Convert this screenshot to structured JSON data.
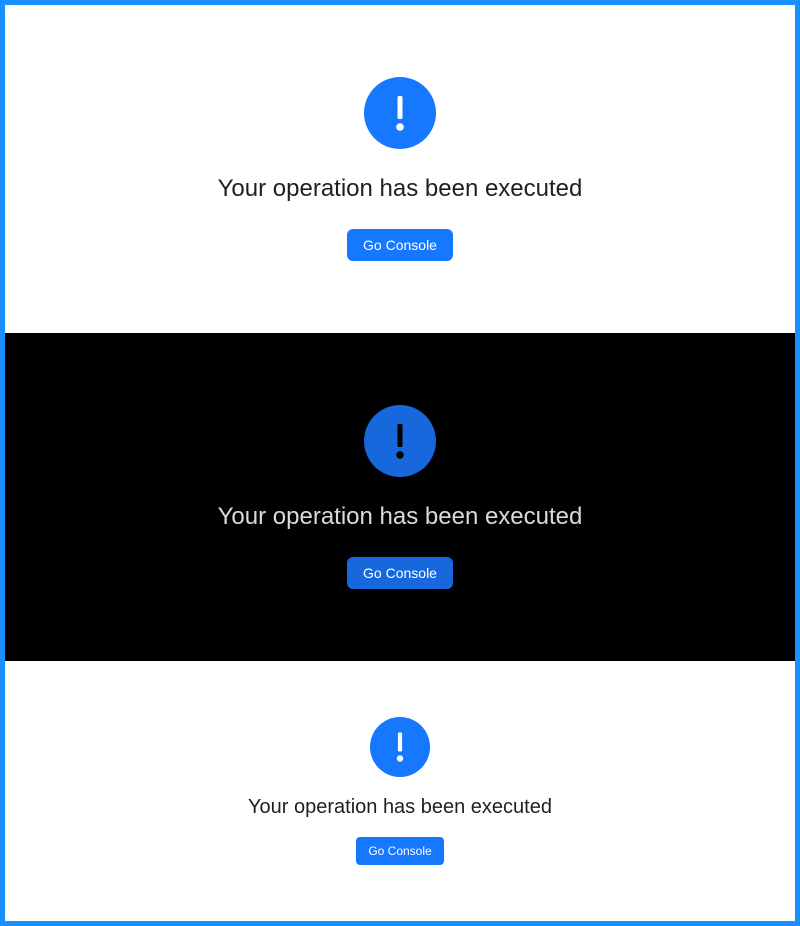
{
  "colors": {
    "outer_border": "#1890ff",
    "primary": "#1677ff",
    "primary_dark": "#1668dc",
    "light_bg": "#ffffff",
    "dark_bg": "#000000"
  },
  "results": [
    {
      "theme": "light",
      "icon": "exclamation-circle-icon",
      "title": "Your operation has been executed",
      "button_label": "Go Console"
    },
    {
      "theme": "dark",
      "icon": "exclamation-circle-icon",
      "title": "Your operation has been executed",
      "button_label": "Go Console"
    },
    {
      "theme": "light-compact",
      "icon": "exclamation-circle-icon",
      "title": "Your operation has been executed",
      "button_label": "Go Console"
    }
  ]
}
